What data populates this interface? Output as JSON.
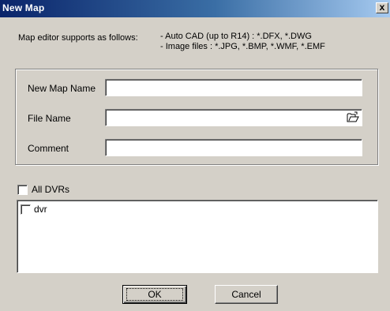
{
  "window": {
    "title": "New Map",
    "close_glyph": "x"
  },
  "info": {
    "label": "Map editor supports as follows:",
    "line1": "- Auto CAD (up to R14) :  *.DFX, *.DWG",
    "line2": "- Image files :  *.JPG, *.BMP, *.WMF, *.EMF"
  },
  "form": {
    "new_map_name_label": "New Map Name",
    "new_map_name_value": "",
    "file_name_label": "File Name",
    "file_name_value": "",
    "comment_label": "Comment",
    "comment_value": "",
    "browse_icon": "folder-open-icon"
  },
  "dvrs": {
    "all_label": "All DVRs",
    "all_checked": false,
    "items": [
      {
        "label": "dvr",
        "checked": false
      }
    ]
  },
  "buttons": {
    "ok_label": "OK",
    "cancel_label": "Cancel"
  }
}
